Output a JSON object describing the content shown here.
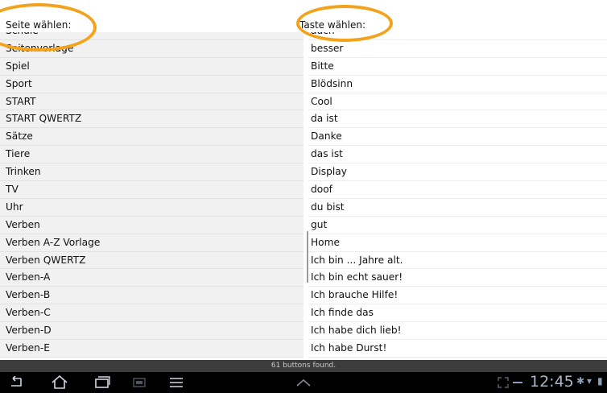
{
  "left_column": {
    "header": "Seite wählen:",
    "items": [
      "Schule",
      "Seitenvorlage",
      "Spiel",
      "Sport",
      "START",
      "START QWERTZ",
      "Sätze",
      "Tiere",
      "Trinken",
      "TV",
      "Uhr",
      "Verben",
      "Verben A-Z Vorlage",
      "Verben QWERTZ",
      "Verben-A",
      "Verben-B",
      "Verben-C",
      "Verben-D",
      "Verben-E"
    ]
  },
  "right_column": {
    "header": "Taste wählen:",
    "items": [
      "auch",
      "besser",
      "Bitte",
      "Blödsinn",
      "Cool",
      "da ist",
      "Danke",
      "das ist",
      "Display",
      "doof",
      "du bist",
      "gut",
      "Home",
      "Ich bin ... Jahre alt.",
      "Ich bin echt sauer!",
      "Ich brauche Hilfe!",
      "Ich finde das",
      "Ich habe dich lieb!",
      "Ich habe Durst!"
    ]
  },
  "status": {
    "text": "61 buttons found."
  },
  "system_bar": {
    "clock": "12:45",
    "icons": [
      "back-icon",
      "home-icon",
      "recent-apps-icon",
      "screenshot-icon",
      "menu-icon",
      "chevron-up-icon",
      "fullscreen-icon",
      "bluetooth-icon",
      "wifi-icon",
      "battery-icon"
    ]
  },
  "colors": {
    "highlight": "#f2a21b",
    "left_row_bg": "#f1f1f1",
    "nav_bg": "#000000"
  }
}
